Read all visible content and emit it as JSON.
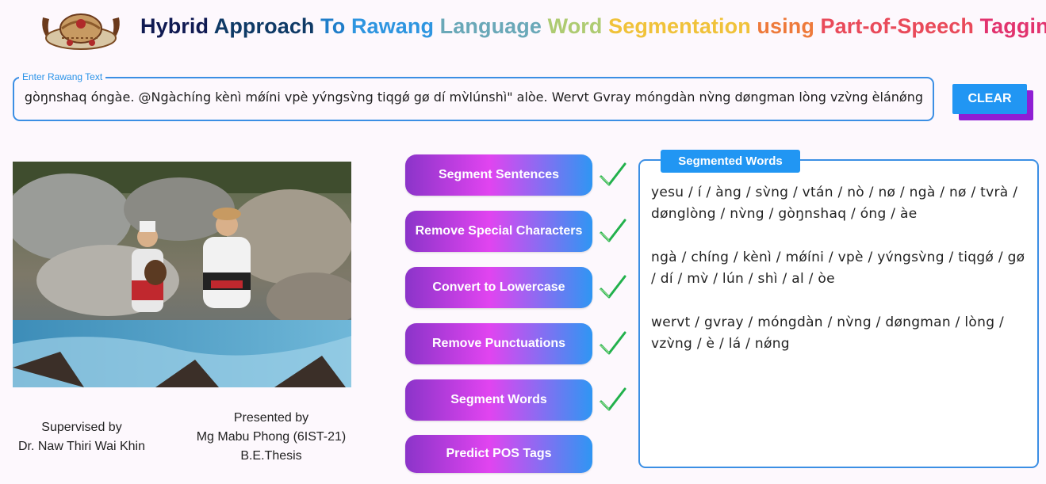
{
  "header": {
    "title_words": [
      {
        "text": "Hybrid ",
        "color": "#101a52"
      },
      {
        "text": "Approach ",
        "color": "#0f3a66"
      },
      {
        "text": "To ",
        "color": "#1f7dc9"
      },
      {
        "text": "Rawang ",
        "color": "#2e95e0"
      },
      {
        "text": "Language ",
        "color": "#6aa8b8"
      },
      {
        "text": "Word ",
        "color": "#aecb72"
      },
      {
        "text": "Segmentation ",
        "color": "#f0c23a"
      },
      {
        "text": "using ",
        "color": "#ee7a3b"
      },
      {
        "text": "Part-of-Speech ",
        "color": "#e94a5a"
      },
      {
        "text": "Tagging",
        "color": "#e2336e"
      }
    ]
  },
  "input": {
    "label": "Enter Rawang Text",
    "value": "yesu í àng sv̀ng vtán nò nø ngà nø tvrà dønglòng nv̀ng gòŋnshaq óngàe. @Ngàchíng kènì mǿíni vpè yv́ngsv̀ng tiqgǿ gø dí mv̀lúnshì\" alòe. Wervt Gvray móngdàn nv̀ng døngman lòng vzv̀ng èlánǿng!",
    "visible_text": "v̀ng gòŋnshaq óngàe. @Ngàchíng kènì mǿíni vpè yv́ngsv̀ng tiqgǿ gø dí mv̀lúnshì\" alòe. Wervt Gvray móngdàn nv̀ng døngman lòng vzv̀ng èlánǿng!"
  },
  "clear_label": "CLEAR",
  "credits": {
    "supervisor_line1": "Supervised by",
    "supervisor_line2": "Dr. Naw Thiri Wai Khin",
    "presenter_line1": "Presented by",
    "presenter_line2": "Mg Mabu Phong (6IST-21)",
    "presenter_line3": "B.E.Thesis"
  },
  "steps": [
    {
      "label": "Segment Sentences",
      "checked": true
    },
    {
      "label": "Remove Special Characters",
      "checked": true
    },
    {
      "label": "Convert to Lowercase",
      "checked": true
    },
    {
      "label": "Remove Punctuations",
      "checked": true
    },
    {
      "label": "Segment Words",
      "checked": true
    },
    {
      "label": "Predict POS Tags",
      "checked": false
    }
  ],
  "segmented": {
    "title": "Segmented Words",
    "paragraphs": [
      "yesu / í / àng / sv̀ng / vtán / nò / nø / ngà / nø / tvrà / dønglòng / nv̀ng / gòŋnshaq / óng / àe",
      "ngà / chíng / kènì / mǿíni / vpè / yv́ngsv̀ng / tiqgǿ / gø / dí / mv̀ / lún / shì / al / òe",
      "wervt / gvray / móngdàn / nv̀ng / døngman / lòng / vzv̀ng / è / lá / nǿng"
    ]
  },
  "colors": {
    "accent_blue": "#2196f3",
    "clear_shadow": "#8f1ed4",
    "check_green": "#22b14c"
  }
}
